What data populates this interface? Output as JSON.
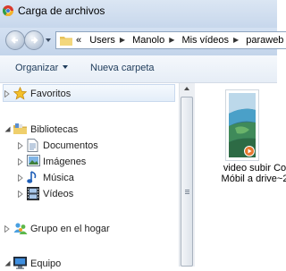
{
  "window": {
    "title": "Carga de archivos",
    "icon": "chrome-icon"
  },
  "address_bar": {
    "overflow": "«",
    "crumbs": [
      "Users",
      "Manolo",
      "Mis vídeos",
      "paraweb"
    ]
  },
  "toolbar": {
    "organize_label": "Organizar",
    "new_folder_label": "Nueva carpeta"
  },
  "nav_pane": {
    "favorites": "Favoritos",
    "libraries": "Bibliotecas",
    "library_items": [
      "Documentos",
      "Imágenes",
      "Música",
      "Vídeos"
    ],
    "homegroup": "Grupo en el hogar",
    "computer": "Equipo"
  },
  "files": [
    {
      "name_line1": "video subir Co",
      "name_line2": "Móbil a drive~2",
      "icon": "video-thumbnail-icon"
    }
  ],
  "colors": {
    "title_bar": "#c7d7ec",
    "toolbar_text": "#1e3b5a",
    "nav_highlight": "#e4eef9",
    "play_badge": "#e8772e"
  }
}
